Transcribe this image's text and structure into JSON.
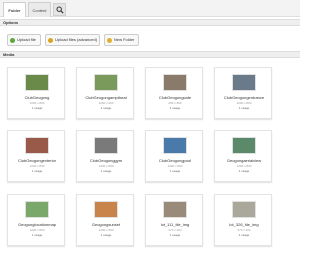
{
  "tabs": {
    "folder_label": "Folder",
    "content_label": "Content"
  },
  "search_icon": "search-icon",
  "sections": {
    "options_label": "Options",
    "media_label": "Media"
  },
  "actions": {
    "upload_file": "Upload file",
    "upload_advanced": "Upload files (advanced)",
    "new_folder": "New Folder"
  },
  "media": [
    {
      "name": "ClubGeogong",
      "dims": "1200 x 800",
      "usage": "1 usage",
      "thumb": "#6a8a4a"
    },
    {
      "name": "ClubGeogongamptheat",
      "dims": "1200 x 900",
      "usage": "1 usage",
      "thumb": "#7a9a5c"
    },
    {
      "name": "ClubGeogongcafe",
      "dims": "283 x 800",
      "usage": "1 usage",
      "thumb": "#8a7a6a"
    },
    {
      "name": "ClubGeogongentrance",
      "dims": "1200 x 800",
      "usage": "1 usage",
      "thumb": "#6a7a8a"
    },
    {
      "name": "ClubGeogongexterior",
      "dims": "1200 x 800",
      "usage": "1 usage",
      "thumb": "#9a5a4a"
    },
    {
      "name": "ClubGeogonggym",
      "dims": "1200 x 800",
      "usage": "1 usage",
      "thumb": "#7a7a7a"
    },
    {
      "name": "ClubGeogongpool",
      "dims": "1200 x 800",
      "usage": "1 usage",
      "thumb": "#4a7aaa"
    },
    {
      "name": "Geogongaerialview",
      "dims": "1200 x 800",
      "usage": "1 usage",
      "thumb": "#5a8a6a"
    },
    {
      "name": "Geogonglocationmap",
      "dims": "1200 x 800",
      "usage": "1 usage",
      "thumb": "#7aa86a"
    },
    {
      "name": "Geogongsunset",
      "dims": "1200 x 800",
      "usage": "1 usage",
      "thumb": "#c8844a"
    },
    {
      "name": "lot_111_tile_img",
      "dims": "373 x 224",
      "usage": "1 usage",
      "thumb": "#9a8a7a"
    },
    {
      "name": "lot_326_tile_img",
      "dims": "373 x 224",
      "usage": "1 usage",
      "thumb": "#aaa89a"
    }
  ]
}
